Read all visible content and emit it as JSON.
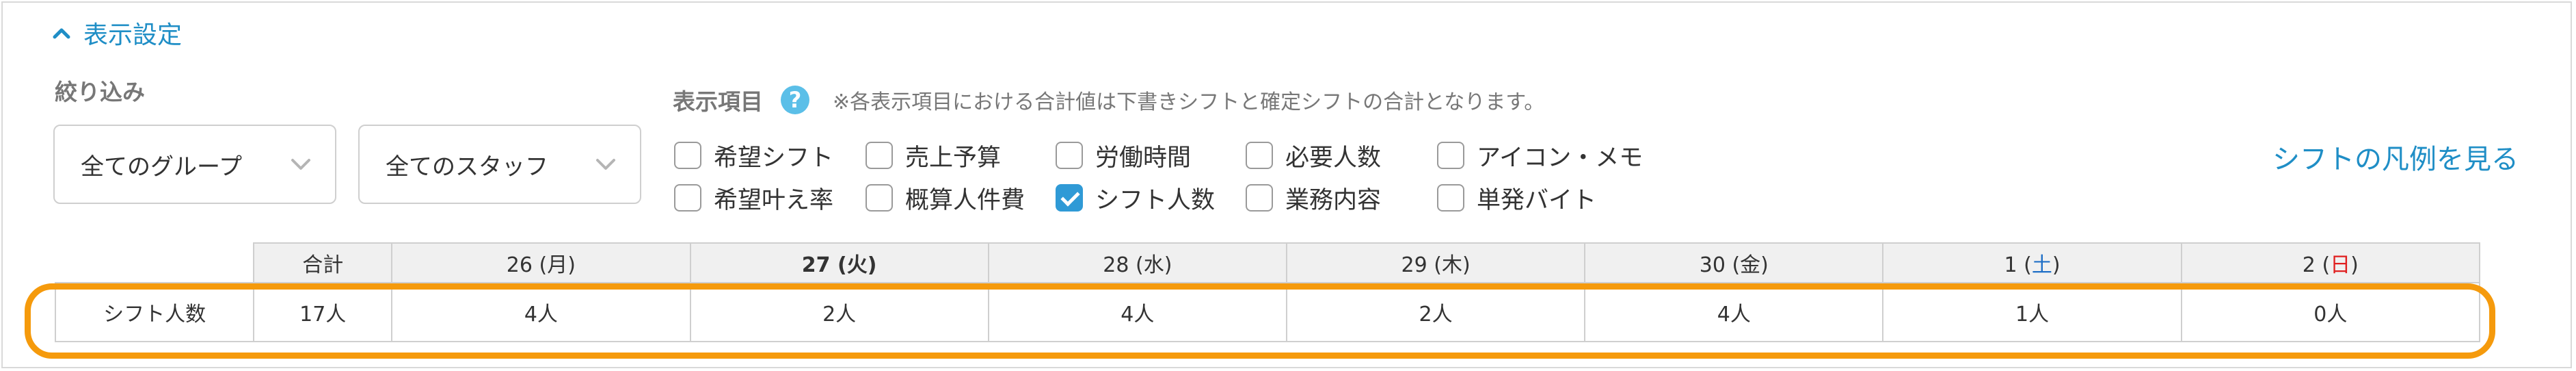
{
  "display_settings": {
    "toggle_label": "表示設定"
  },
  "filter": {
    "label": "絞り込み",
    "group_select": "全てのグループ",
    "staff_select": "全てのスタッフ"
  },
  "display_items": {
    "label": "表示項目",
    "help_icon": "?",
    "note": "※各表示項目における合計値は下書きシフトと確定シフトの合計となります。",
    "checkboxes": [
      {
        "label": "希望シフト",
        "checked": false
      },
      {
        "label": "売上予算",
        "checked": false
      },
      {
        "label": "労働時間",
        "checked": false
      },
      {
        "label": "必要人数",
        "checked": false
      },
      {
        "label": "アイコン・メモ",
        "checked": false
      },
      {
        "label": "希望叶え率",
        "checked": false
      },
      {
        "label": "概算人件費",
        "checked": false
      },
      {
        "label": "シフト人数",
        "checked": true
      },
      {
        "label": "業務内容",
        "checked": false
      },
      {
        "label": "単発バイト",
        "checked": false
      }
    ]
  },
  "legend_link": "シフトの凡例を見る",
  "table": {
    "headers": {
      "total": "合計",
      "d1": {
        "day": "26",
        "wd": "(月)"
      },
      "d2": {
        "day": "27",
        "wd": "(火)"
      },
      "d3": {
        "day": "28",
        "wd": "(水)"
      },
      "d4": {
        "day": "29",
        "wd": "(木)"
      },
      "d5": {
        "day": "30",
        "wd": "(金)"
      },
      "d6": {
        "day": "1",
        "wd_open": "(",
        "wd_char": "土",
        "wd_close": ")"
      },
      "d7": {
        "day": "2",
        "wd_open": "(",
        "wd_char": "日",
        "wd_close": ")"
      }
    },
    "row": {
      "label": "シフト人数",
      "total": "17人",
      "values": [
        "4人",
        "2人",
        "4人",
        "2人",
        "4人",
        "1人",
        "0人"
      ]
    }
  },
  "colors": {
    "accent": "#1f8ec6",
    "checkbox_checked": "#2f9ad6",
    "highlight": "#f59a0c",
    "saturday": "#1f6fc6",
    "sunday": "#e02020"
  },
  "icons": [
    "chevron-up-icon",
    "chevron-down-icon",
    "help-icon",
    "check-icon"
  ]
}
